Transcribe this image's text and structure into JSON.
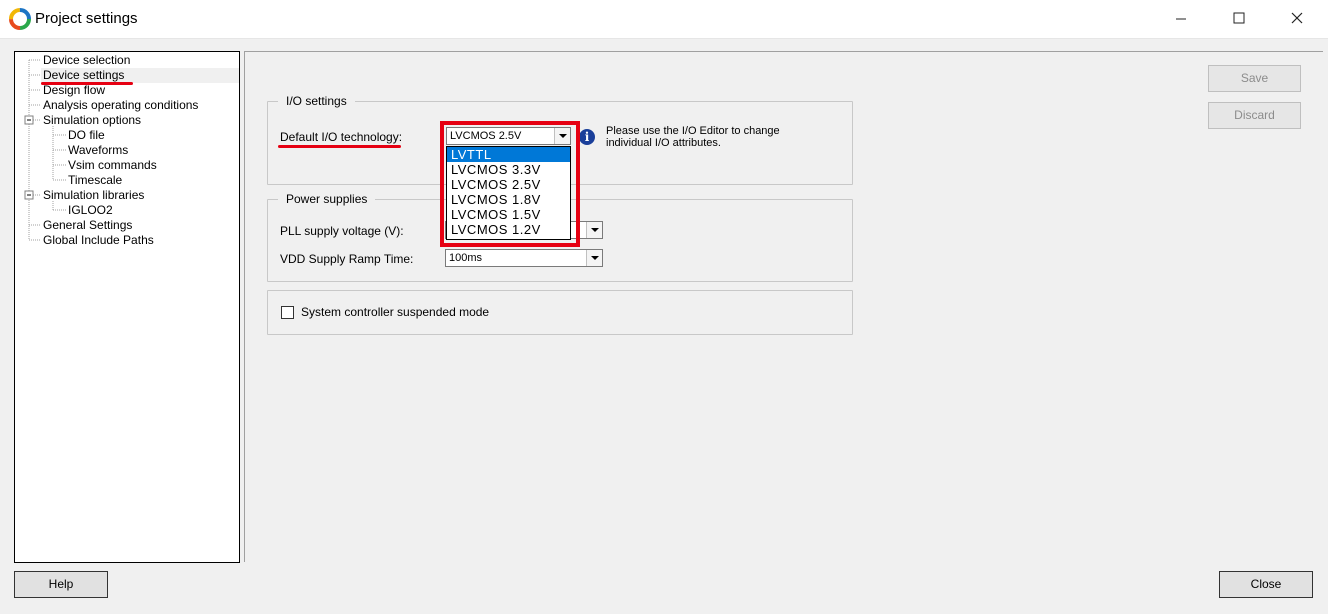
{
  "window": {
    "title": "Project settings",
    "minimize": "—",
    "close": "✕"
  },
  "tree": {
    "items": [
      {
        "label": "Device selection"
      },
      {
        "label": "Device settings"
      },
      {
        "label": "Design flow"
      },
      {
        "label": "Analysis operating conditions"
      },
      {
        "label": "Simulation options"
      },
      {
        "label": "DO file"
      },
      {
        "label": "Waveforms"
      },
      {
        "label": "Vsim commands"
      },
      {
        "label": "Timescale"
      },
      {
        "label": "Simulation libraries"
      },
      {
        "label": "IGLOO2"
      },
      {
        "label": "General Settings"
      },
      {
        "label": "Global Include Paths"
      }
    ]
  },
  "io_settings": {
    "legend": "I/O settings",
    "default_label": "Default I/O technology:",
    "selected": "LVCMOS 2.5V",
    "options": [
      "LVTTL",
      "LVCMOS 3.3V",
      "LVCMOS 2.5V",
      "LVCMOS 1.8V",
      "LVCMOS 1.5V",
      "LVCMOS 1.2V"
    ],
    "info_line1": "Please use the I/O Editor to change",
    "info_line2": "individual I/O attributes.",
    "info_glyph": "i"
  },
  "power": {
    "legend": "Power supplies",
    "pll_label": "PLL supply voltage (V):",
    "vdd_label": "VDD Supply  Ramp Time:",
    "vdd_value": "100ms"
  },
  "system": {
    "checkbox_label": "System controller suspended mode"
  },
  "buttons": {
    "save": "Save",
    "discard": "Discard",
    "help": "Help",
    "close": "Close"
  },
  "colors": {
    "highlight": "#0078d7",
    "annotation_red": "#e60012",
    "info_blue": "#1a3f9a"
  }
}
